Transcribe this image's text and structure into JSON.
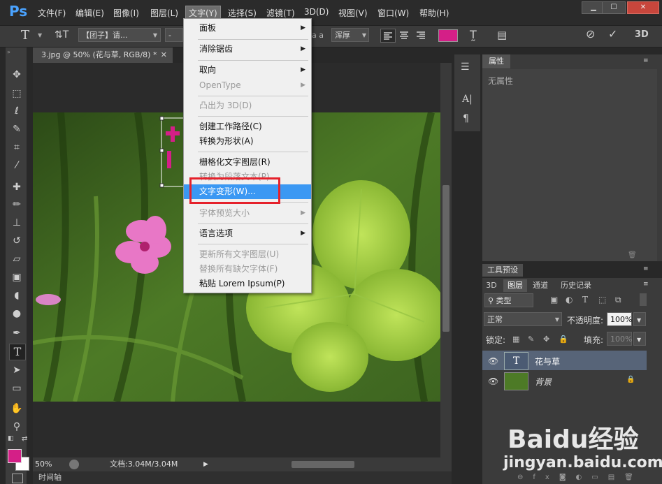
{
  "app": {
    "logo": "Ps"
  },
  "menubar": {
    "items": [
      "文件(F)",
      "编辑(E)",
      "图像(I)",
      "图层(L)",
      "文字(Y)",
      "选择(S)",
      "滤镜(T)",
      "3D(D)",
      "视图(V)",
      "窗口(W)",
      "帮助(H)"
    ]
  },
  "window_buttons": {
    "minimize": "▁",
    "maximize": "☐",
    "close": "✕"
  },
  "options_bar": {
    "font_family": "【团子】请...",
    "antialias": "浑厚",
    "aa_label": "a a"
  },
  "document": {
    "tab_title": "3.jpg @ 50% (花与草, RGB/8) *",
    "zoom": "50%",
    "doc_info": "文档:3.04M/3.04M"
  },
  "timeline": {
    "label": "时间轴"
  },
  "text_menu": {
    "items": [
      {
        "label": "面板",
        "submenu": true,
        "enabled": true
      },
      {
        "label": "消除锯齿",
        "submenu": true,
        "enabled": true
      },
      {
        "label": "取向",
        "submenu": true,
        "enabled": true
      },
      {
        "label": "OpenType",
        "submenu": true,
        "enabled": false
      },
      {
        "label": "凸出为 3D(D)",
        "submenu": false,
        "enabled": false
      },
      {
        "label": "创建工作路径(C)",
        "submenu": false,
        "enabled": true
      },
      {
        "label": "转换为形状(A)",
        "submenu": false,
        "enabled": true
      },
      {
        "label": "栅格化文字图层(R)",
        "submenu": false,
        "enabled": true
      },
      {
        "label": "转换为段落文本(P)",
        "submenu": false,
        "enabled": false
      },
      {
        "label": "文字变形(W)...",
        "submenu": false,
        "enabled": true,
        "highlighted": true
      },
      {
        "label": "字体预览大小",
        "submenu": true,
        "enabled": false
      },
      {
        "label": "语言选项",
        "submenu": true,
        "enabled": true
      },
      {
        "label": "更新所有文字图层(U)",
        "submenu": false,
        "enabled": false
      },
      {
        "label": "替换所有缺欠字体(F)",
        "submenu": false,
        "enabled": false
      },
      {
        "label": "粘贴 Lorem Ipsum(P)",
        "submenu": false,
        "enabled": true
      }
    ],
    "submenu_arrow": "▶"
  },
  "properties_panel": {
    "tab": "属性",
    "empty_text": "无属性"
  },
  "presets_panel": {
    "tab": "工具预设"
  },
  "layers_panel": {
    "tabs": [
      "3D",
      "图层",
      "通道",
      "历史记录"
    ],
    "filter_label": "类型",
    "blend_mode": "正常",
    "opacity_label": "不透明度:",
    "opacity_value": "100%",
    "lock_label": "锁定:",
    "fill_label": "填充:",
    "fill_value": "100%",
    "layers": [
      {
        "name": "花与草",
        "type": "text",
        "selected": true
      },
      {
        "name": "背景",
        "type": "image",
        "selected": false,
        "locked": true
      }
    ]
  },
  "colors": {
    "foreground": "#d41f87",
    "background": "#ffffff",
    "menu_highlight": "#3b98f3",
    "callout_box": "#e5212b"
  },
  "watermark": {
    "brand": "Baidu经验",
    "url": "jingyan.baidu.com"
  }
}
